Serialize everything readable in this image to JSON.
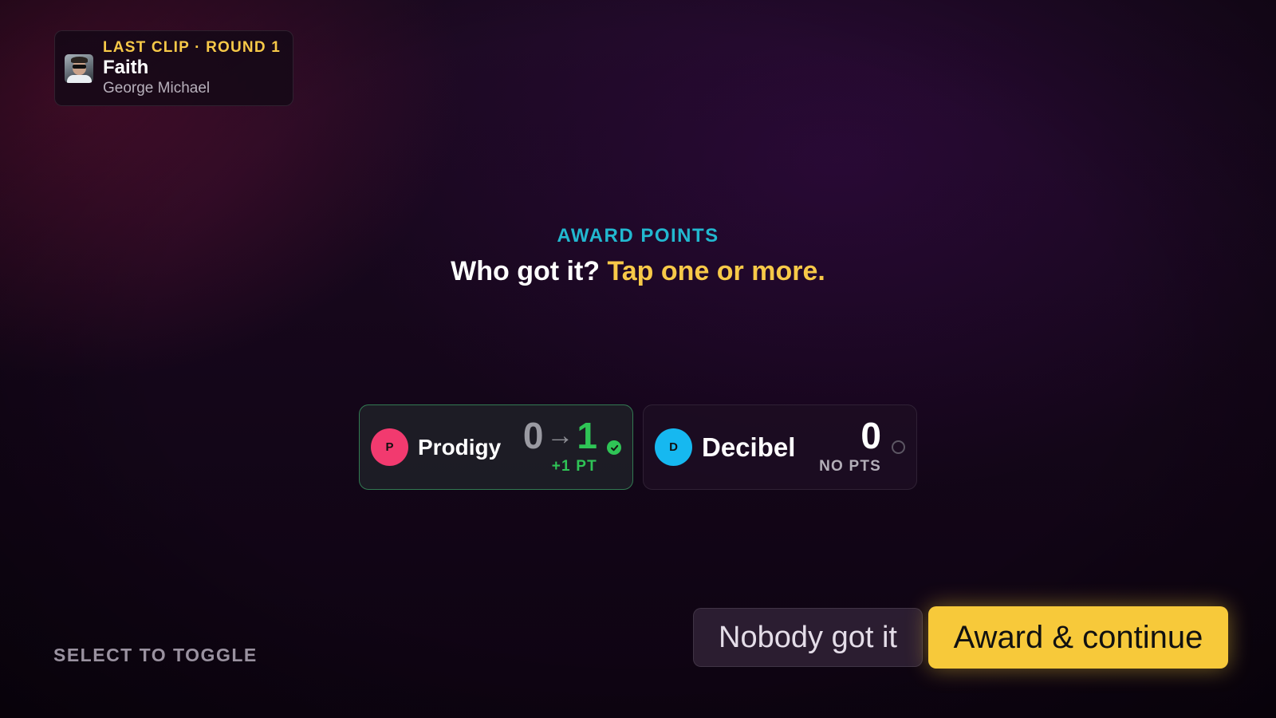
{
  "last_clip": {
    "label": "LAST CLIP · ROUND 1",
    "title": "Faith",
    "artist": "George Michael",
    "art_icon": "album-art-icon"
  },
  "heading": {
    "eyebrow": "AWARD POINTS",
    "question": "Who got it?",
    "instruction": "Tap one or more."
  },
  "players": [
    {
      "name": "Prodigy",
      "initial": "P",
      "color": "#f23a6f",
      "selected": true,
      "score_before": "0",
      "arrow": "→",
      "score_after": "1",
      "note": "+1 PT",
      "status_icon": "check-circle-icon"
    },
    {
      "name": "Decibel",
      "initial": "D",
      "color": "#16b8f0",
      "selected": false,
      "score": "0",
      "note": "NO PTS",
      "status_icon": "empty-circle-icon"
    }
  ],
  "footer": {
    "hint": "SELECT TO TOGGLE",
    "nobody_label": "Nobody got it",
    "award_label": "Award & continue"
  },
  "colors": {
    "accent_yellow": "#f7c948",
    "accent_cyan": "#22b8cf",
    "success_green": "#2fc456"
  }
}
